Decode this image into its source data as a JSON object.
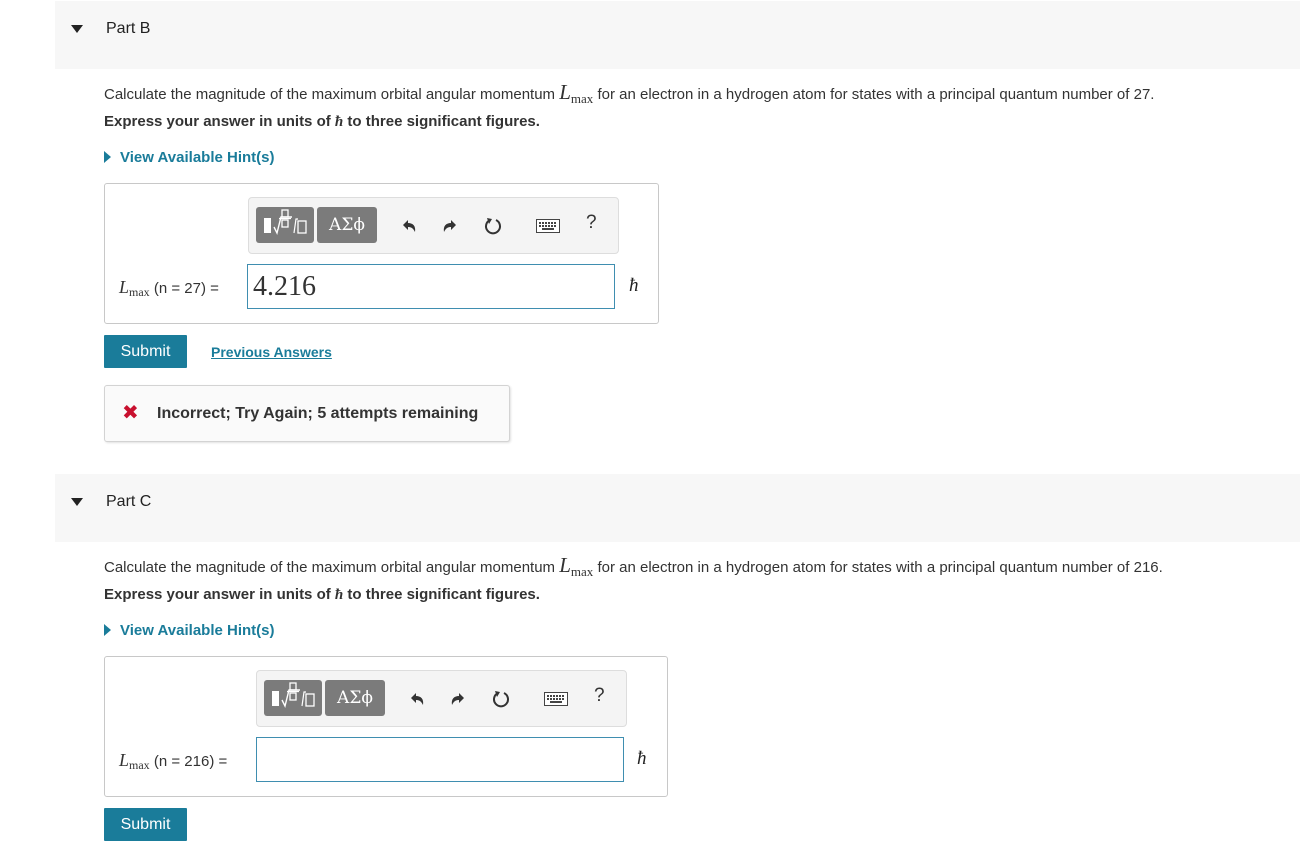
{
  "colors": {
    "accent": "#1a7c9a",
    "error": "#c8102e",
    "header_bg": "#f7f7f7"
  },
  "toolbar": {
    "greek_label": "ΑΣϕ",
    "undo_icon": "undo-icon",
    "redo_icon": "redo-icon",
    "reset_icon": "reset-icon",
    "keyboard_icon": "keyboard-icon",
    "help_label": "?"
  },
  "partB": {
    "title": "Part B",
    "question_pre": "Calculate the magnitude of the maximum orbital angular momentum ",
    "symbol_L": "L",
    "symbol_sub": "max",
    "question_post": " for an electron in a hydrogen atom for states with a principal quantum number of 27.",
    "express_pre": "Express your answer in units of ",
    "express_symbol": "ħ",
    "express_post": " to three significant figures.",
    "hint_label": "View Available Hint(s)",
    "answer_label_n": "(n = 27) =",
    "answer_value": "4.216",
    "unit": "ħ",
    "submit_label": "Submit",
    "previous_answers_label": "Previous Answers",
    "feedback": "Incorrect; Try Again; 5 attempts remaining"
  },
  "partC": {
    "title": "Part C",
    "question_pre": "Calculate the magnitude of the maximum orbital angular momentum ",
    "symbol_L": "L",
    "symbol_sub": "max",
    "question_post": " for an electron in a hydrogen atom for states with a principal quantum number of 216.",
    "express_pre": "Express your answer in units of ",
    "express_symbol": "ħ",
    "express_post": " to three significant figures.",
    "hint_label": "View Available Hint(s)",
    "answer_label_n": "(n = 216) =",
    "answer_value": "",
    "unit": "ħ",
    "submit_label": "Submit"
  }
}
